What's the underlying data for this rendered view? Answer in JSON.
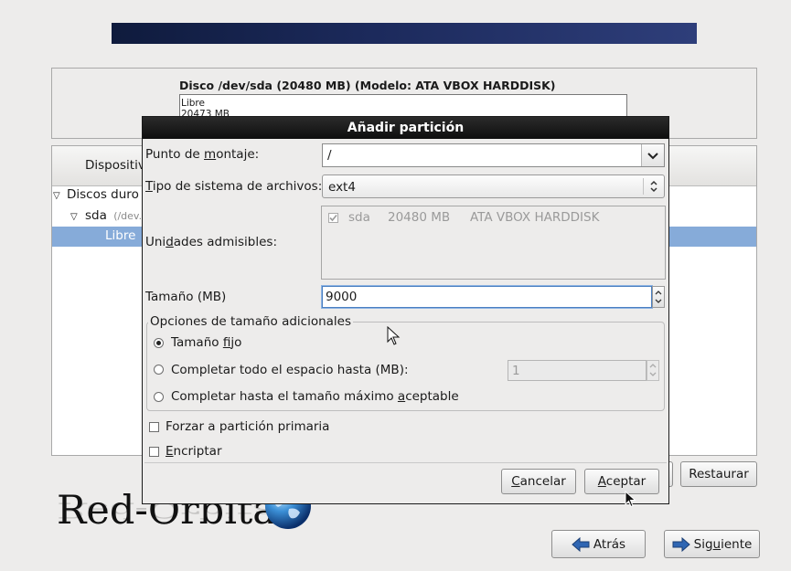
{
  "disk": {
    "title": "Disco /dev/sda (20480 MB) (Modelo: ATA VBOX HARDDISK)",
    "bar_label": "Libre",
    "bar_size": "20473 MB"
  },
  "tree": {
    "column_header": "Dispositiv",
    "group": "Discos duro",
    "device": "sda",
    "device_path": "(/dev.",
    "free": "Libre"
  },
  "dialog": {
    "title": "Añadir partición",
    "mount_label_pre": "Punto de ",
    "mount_label_key": "m",
    "mount_label_post": "ontaje:",
    "mount_value": "/",
    "fs_label_key": "T",
    "fs_label_post": "ipo de sistema de archivos:",
    "fs_value": "ext4",
    "drives_label_pre": "Uni",
    "drives_label_key": "d",
    "drives_label_post": "ades admisibles:",
    "drive_name": "sda",
    "drive_size": "20480 MB",
    "drive_model": "ATA VBOX HARDDISK",
    "size_label": "Tamaño (MB)",
    "size_value": "9000",
    "options_title": "Opciones de tamaño adicionales",
    "opt_fixed_pre": "Tamaño ",
    "opt_fixed_key": "f",
    "opt_fixed_post": "ijo",
    "opt_fill_upto": "Completar todo el espacio hasta (MB):",
    "opt_fill_upto_value": "1",
    "opt_fill_max_pre": "Completar hasta el tamaño máximo ",
    "opt_fill_max_key": "a",
    "opt_fill_max_post": "ceptable",
    "force_primary": "Forzar a partición primaria",
    "encrypt_key": "E",
    "encrypt_post": "ncriptar",
    "cancel_key": "C",
    "cancel_post": "ancelar",
    "accept_key": "A",
    "accept_post": "ceptar"
  },
  "buttons": {
    "restore": "Restaurar",
    "back": "Atrás",
    "next_pre": "Sig",
    "next_key": "u",
    "next_post": "iente"
  },
  "watermark": "Red-Orbita"
}
